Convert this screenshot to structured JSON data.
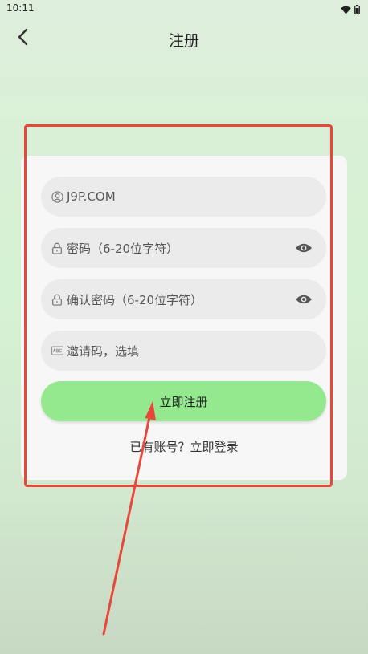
{
  "status_bar": {
    "time": "10:11"
  },
  "nav": {
    "title": "注册",
    "back_icon": "chevron-left-icon"
  },
  "form": {
    "username": {
      "value": "J9P.COM",
      "icon": "user-circle-icon"
    },
    "password": {
      "placeholder": "密码（6-20位字符）",
      "icon": "lock-icon",
      "toggle_icon": "eye-icon"
    },
    "confirm_password": {
      "placeholder": "确认密码（6-20位字符）",
      "icon": "lock-icon",
      "toggle_icon": "eye-icon"
    },
    "invite_code": {
      "placeholder": "邀请码，选填",
      "icon": "abc-keyboard-icon"
    },
    "submit_label": "立即注册",
    "login_prompt": "已有账号？",
    "login_link": "立即登录"
  },
  "colors": {
    "submit_bg": "#94e98f",
    "annotation": "#e8473a",
    "field_bg": "#ebebeb",
    "card_bg": "#f7f7f7"
  }
}
